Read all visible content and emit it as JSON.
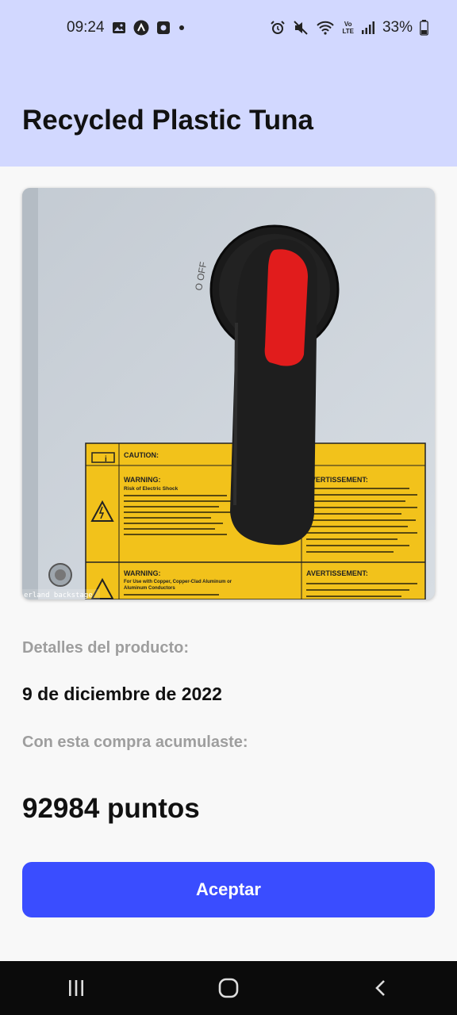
{
  "status_bar": {
    "time": "09:24",
    "battery": "33%",
    "left_icons": [
      "gallery-icon",
      "app-a-icon",
      "app-square-icon",
      "dot-icon"
    ],
    "right_icons": [
      "alarm-icon",
      "mute-icon",
      "wifi-icon",
      "volte-icon",
      "signal-icon",
      "battery-icon"
    ],
    "volte_top": "Vo",
    "volte_bottom": "LTE"
  },
  "header": {
    "title": "Recycled Plastic Tuna",
    "background": "#d2d8ff"
  },
  "product": {
    "image_icon": "product-photo",
    "image_overlay_text": "erland backstage",
    "image_label": {
      "caution": "CAUTION:",
      "warning_1": "WARNING:",
      "warning_1_sub": "Risk of Electric Shock",
      "warning_2": "WARNING:",
      "warning_2_sub": "For Use with Copper, Copper-Clad Aluminum or",
      "warning_2_sub2": "Aluminum Conductors",
      "avert_1": "AVERTISSEMENT:",
      "avert_2": "AVERTISSEMENT:",
      "handle_marking": "O OFF"
    },
    "details_label": "Detalles del producto:",
    "date": "9 de diciembre de 2022",
    "accumulated_label": "Con esta compra acumulaste:",
    "points": "92984 puntos"
  },
  "actions": {
    "accept_label": "Aceptar",
    "accent": "#3a4dff"
  },
  "nav_bar": {
    "icons": [
      "recent-apps-icon",
      "home-icon",
      "back-icon"
    ]
  }
}
